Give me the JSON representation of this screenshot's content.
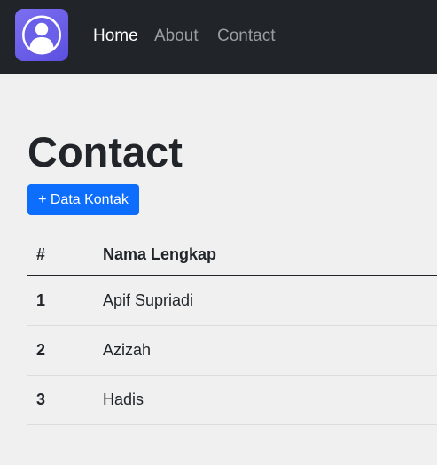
{
  "navbar": {
    "brand_icon": "user-avatar-icon",
    "brand_color": "#6a5fe8",
    "links": [
      {
        "label": "Home",
        "active": true
      },
      {
        "label": "About",
        "active": false
      },
      {
        "label": "Contact",
        "active": false
      }
    ]
  },
  "main": {
    "title": "Contact",
    "add_button_label": "+ Data Kontak",
    "add_button_color": "#0d6efd",
    "table": {
      "headers": [
        "#",
        "Nama Lengkap"
      ],
      "rows": [
        {
          "num": "1",
          "name": "Apif Supriadi"
        },
        {
          "num": "2",
          "name": "Azizah"
        },
        {
          "num": "3",
          "name": "Hadis"
        }
      ]
    }
  }
}
